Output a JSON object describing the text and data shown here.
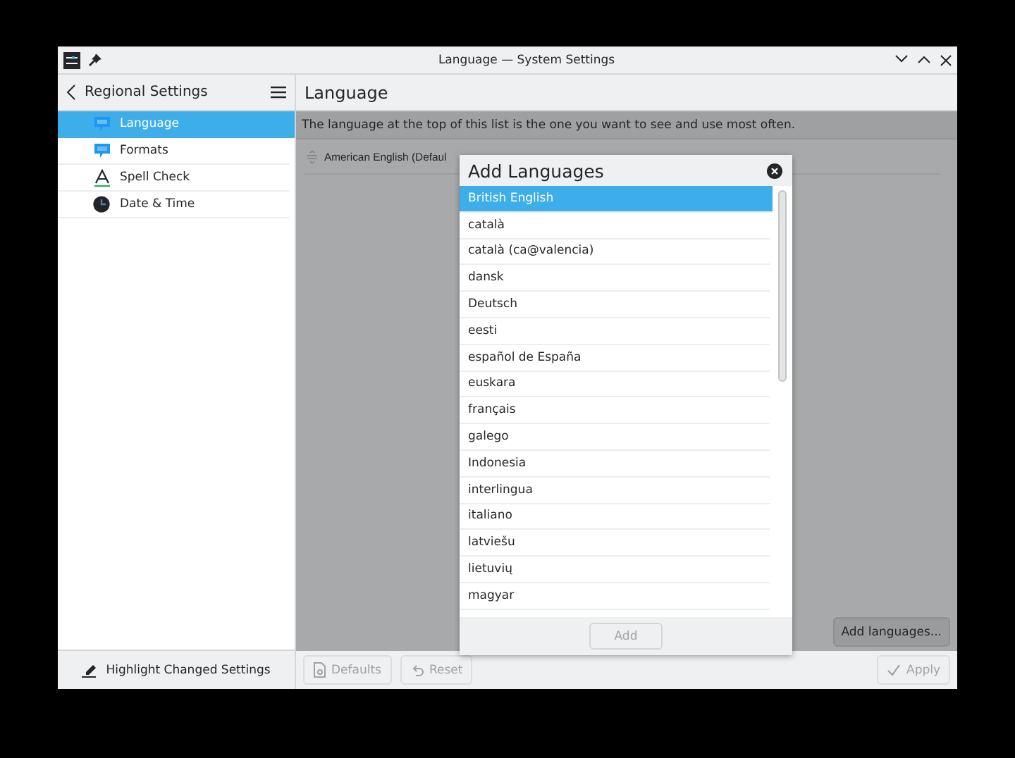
{
  "window": {
    "title": "Language — System Settings"
  },
  "sidebar": {
    "title": "Regional Settings",
    "items": [
      {
        "label": "Language",
        "kind": "bubble",
        "selected": true
      },
      {
        "label": "Formats",
        "kind": "bubble",
        "selected": false
      },
      {
        "label": "Spell Check",
        "kind": "spell",
        "selected": false
      },
      {
        "label": "Date & Time",
        "kind": "clock",
        "selected": false
      }
    ],
    "footer_button": "Highlight Changed Settings"
  },
  "page": {
    "title": "Language",
    "info": "The language at the top of this list is the one you want to see and use most often.",
    "languages": [
      "American English (Defaul"
    ],
    "add_button": "Add languages..."
  },
  "footer": {
    "buttons": [
      {
        "label": "Defaults",
        "kind": "defaults",
        "disabled": true
      },
      {
        "label": "Reset",
        "kind": "reset",
        "disabled": true
      },
      {
        "label": "Apply",
        "kind": "apply",
        "disabled": true
      }
    ]
  },
  "dialog": {
    "title": "Add Languages",
    "items": [
      {
        "label": "British English",
        "selected": true
      },
      {
        "label": "català",
        "selected": false
      },
      {
        "label": "català (ca@valencia)",
        "selected": false
      },
      {
        "label": "dansk",
        "selected": false
      },
      {
        "label": "Deutsch",
        "selected": false
      },
      {
        "label": "eesti",
        "selected": false
      },
      {
        "label": "español de España",
        "selected": false
      },
      {
        "label": "euskara",
        "selected": false
      },
      {
        "label": "français",
        "selected": false
      },
      {
        "label": "galego",
        "selected": false
      },
      {
        "label": "Indonesia",
        "selected": false
      },
      {
        "label": "interlingua",
        "selected": false
      },
      {
        "label": "italiano",
        "selected": false
      },
      {
        "label": "latviešu",
        "selected": false
      },
      {
        "label": "lietuvių",
        "selected": false
      },
      {
        "label": "magyar",
        "selected": false
      }
    ],
    "button": {
      "label": "Add",
      "disabled": true
    }
  }
}
